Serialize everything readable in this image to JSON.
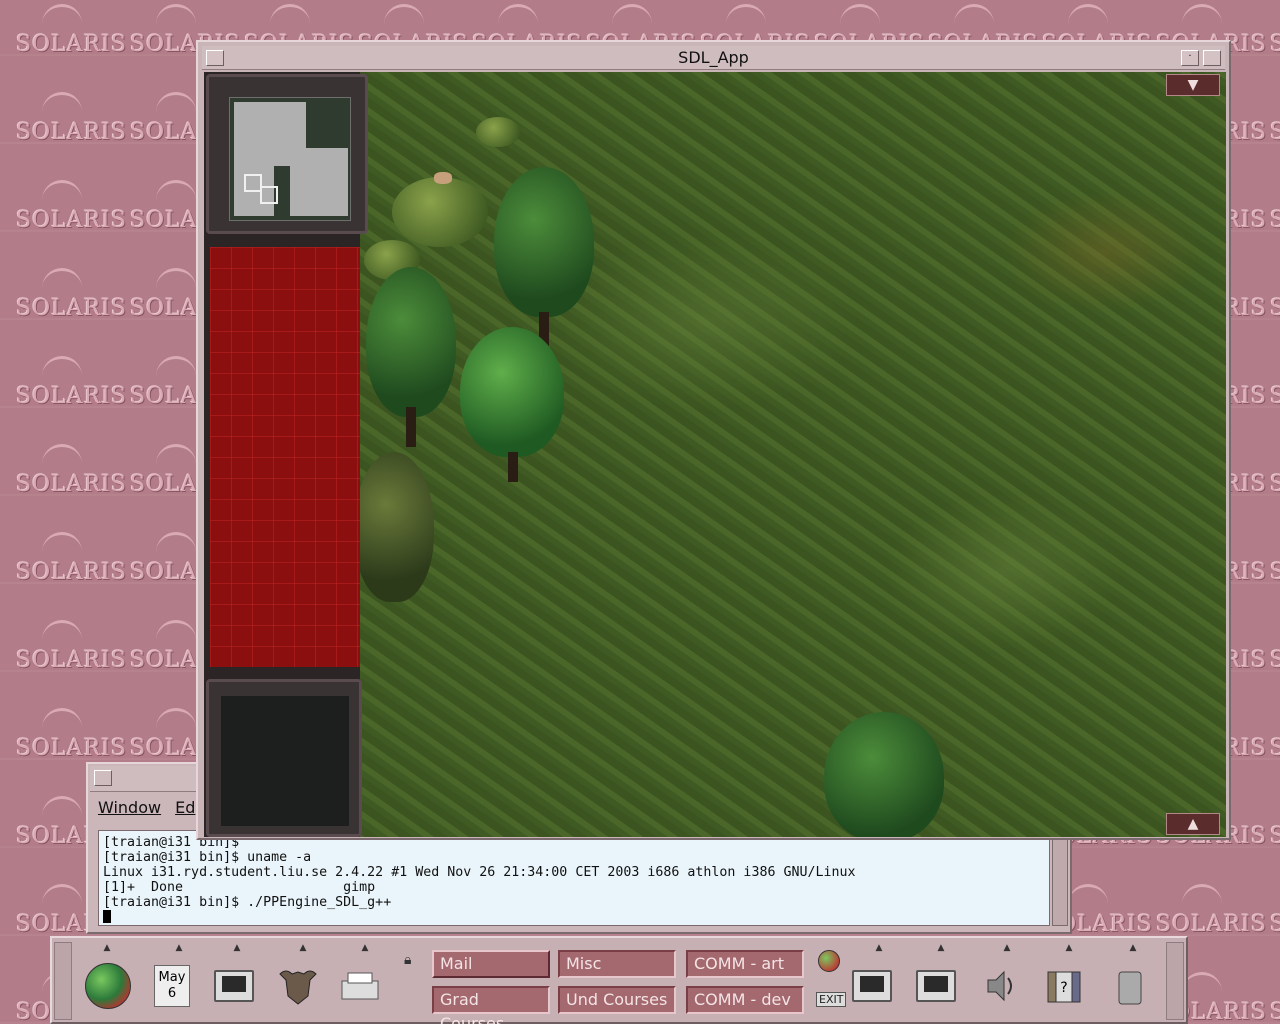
{
  "desktop": {
    "wallpaper_logo": "SOLARIS"
  },
  "sdl_window": {
    "title": "SDL_App",
    "min_glyph": "·",
    "scroll_up": "▲",
    "scroll_down": "▼"
  },
  "terminal": {
    "menu": [
      "Window",
      "Ed"
    ],
    "lines": [
      "[traian@i31 bin]$",
      "[traian@i31 bin]$ uname -a",
      "Linux i31.ryd.student.liu.se 2.4.22 #1 Wed Nov 26 21:34:00 CET 2003 i686 athlon i386 GNU/Linux",
      "[1]+  Done                    gimp",
      "[traian@i31 bin]$ ./PPEngine_SDL_g++"
    ]
  },
  "front_panel": {
    "calendar_month": "May",
    "calendar_day": "6",
    "exit_label": "EXIT",
    "workspaces": [
      "Mail",
      "Misc",
      "COMM - art",
      "Grad Courses",
      "Und Courses",
      "COMM - dev"
    ],
    "active_workspace": "Mail",
    "icons": [
      "globe-icon",
      "calendar-icon",
      "computer-icon",
      "gnu-icon",
      "printer-icon",
      "lock-icon",
      "small-globe-icon",
      "terminal-icon",
      "workstation-icon",
      "audio-icon",
      "help-books-icon",
      "trash-icon"
    ]
  }
}
